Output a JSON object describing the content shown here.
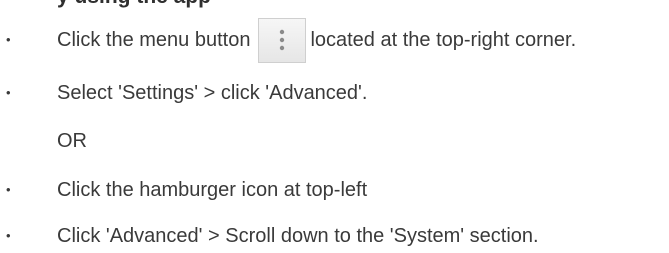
{
  "heading_fragment": "y using the app",
  "steps": [
    {
      "before": "Click the menu button",
      "after": "located at the top-right corner."
    },
    {
      "text": "Select 'Settings' > click 'Advanced'."
    },
    {
      "text": "OR"
    },
    {
      "text": "Click the hamburger icon at top-left"
    },
    {
      "text": "Click 'Advanced' > Scroll down to the 'System' section."
    }
  ],
  "bullet_glyph": "•",
  "inline_icon": "vertical-dots-menu-icon"
}
